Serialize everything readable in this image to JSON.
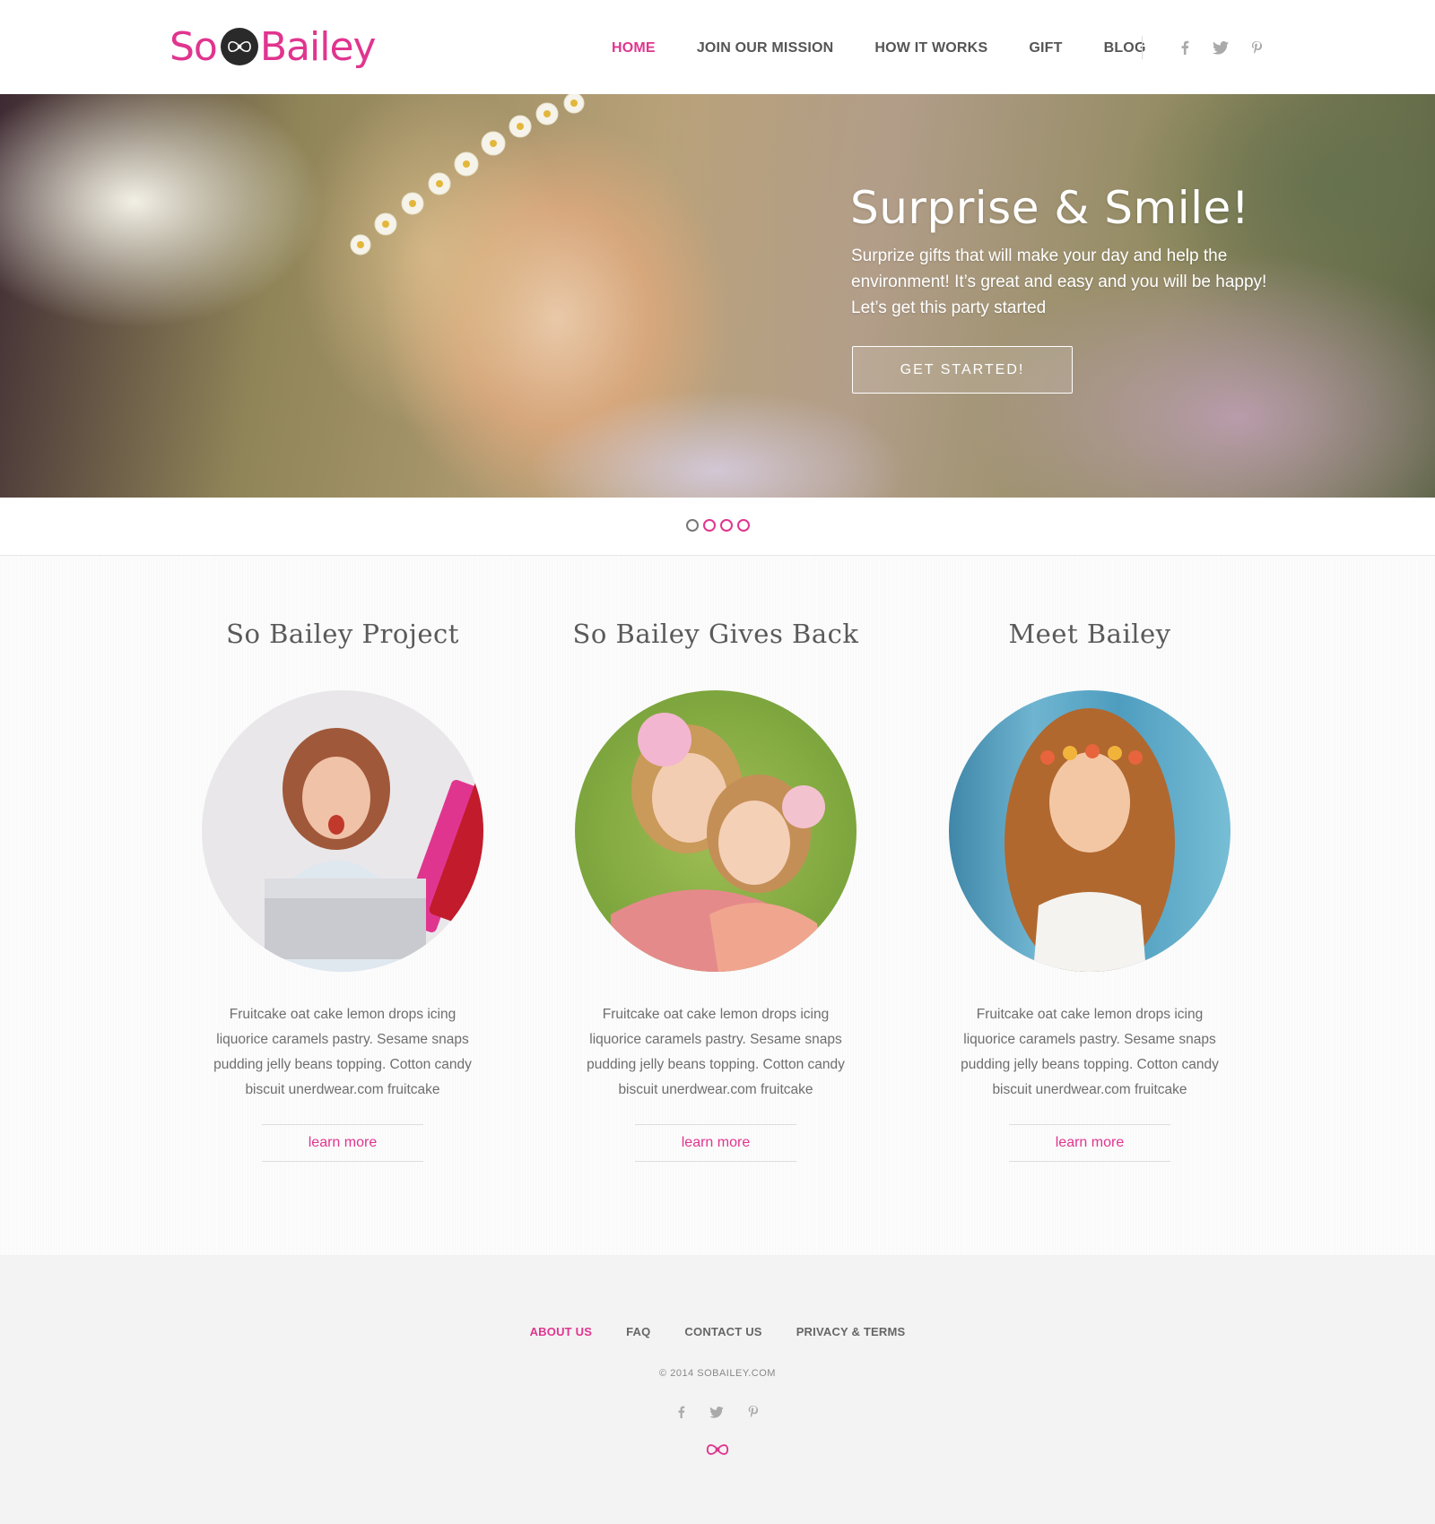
{
  "brand": {
    "name_prefix": "So",
    "name_suffix": "Bailey",
    "accent": "#e0358f",
    "badge_icon": "bow-icon"
  },
  "nav": {
    "items": [
      {
        "label": "HOME",
        "active": true
      },
      {
        "label": "JOIN OUR MISSION",
        "active": false
      },
      {
        "label": "HOW IT WORKS",
        "active": false
      },
      {
        "label": "GIFT",
        "active": false
      },
      {
        "label": "BLOG",
        "active": false
      }
    ],
    "social": [
      "facebook-icon",
      "twitter-icon",
      "pinterest-icon"
    ]
  },
  "hero": {
    "title": "Surprise & Smile!",
    "text": "Surprize gifts that will make your day and help the environment! It’s great and easy and you will be happy! Let’s get this party started",
    "button": "GET STARTED!",
    "slides_total": 4,
    "slide_active": 1
  },
  "features": [
    {
      "title": "So Bailey Project",
      "text": "Fruitcake oat cake lemon drops icing liquorice caramels pastry. Sesame snaps pudding jelly beans topping. Cotton candy biscuit unerdwear.com fruitcake",
      "link": "learn more"
    },
    {
      "title": "So Bailey Gives Back",
      "text": "Fruitcake oat cake lemon drops icing liquorice caramels pastry. Sesame snaps pudding jelly beans topping. Cotton candy biscuit unerdwear.com fruitcake",
      "link": "learn more"
    },
    {
      "title": "Meet Bailey",
      "text": "Fruitcake oat cake lemon drops icing liquorice caramels pastry. Sesame snaps pudding jelly beans topping. Cotton candy biscuit unerdwear.com fruitcake",
      "link": "learn more"
    }
  ],
  "footer": {
    "links": [
      {
        "label": "ABOUT US",
        "active": true
      },
      {
        "label": "FAQ",
        "active": false
      },
      {
        "label": "CONTACT US",
        "active": false
      },
      {
        "label": "PRIVACY & TERMS",
        "active": false
      }
    ],
    "copyright": "© 2014 SOBAILEY.COM",
    "social": [
      "facebook-icon",
      "twitter-icon",
      "pinterest-icon"
    ],
    "bottom_icon": "bow-icon"
  }
}
